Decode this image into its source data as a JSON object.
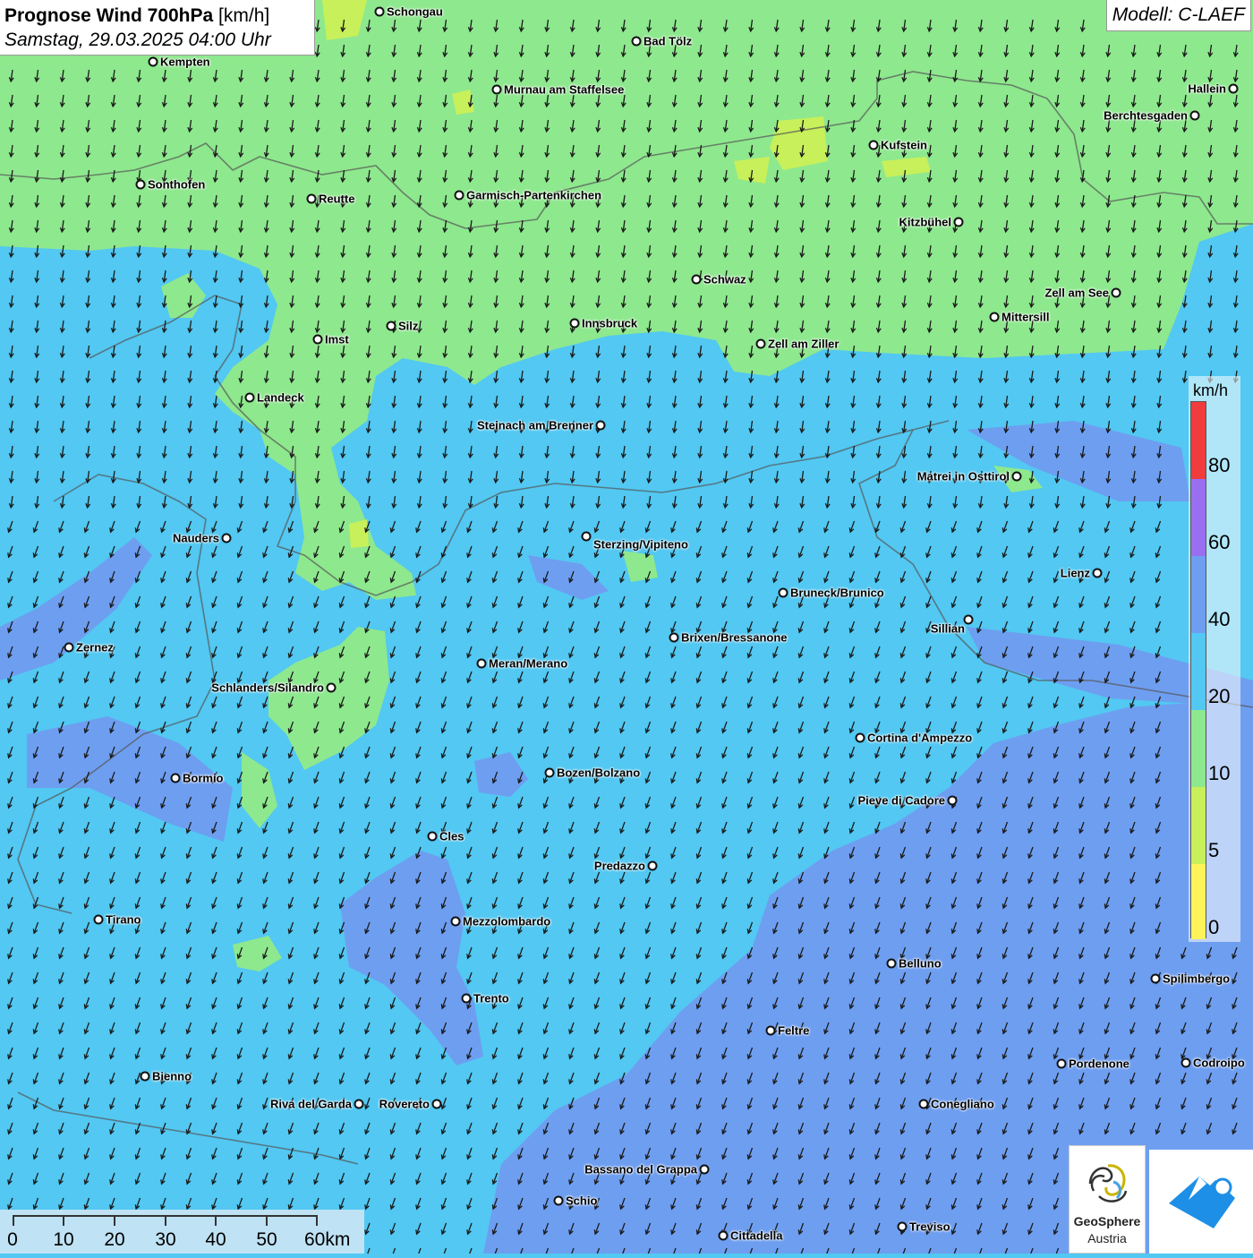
{
  "title": {
    "main": "Prognose Wind 700hPa",
    "unit": "[km/h]",
    "datetime": "Samstag, 29.03.2025 04:00 Uhr"
  },
  "model_label": "Modell: C-LAEF",
  "legend": {
    "unit": "km/h",
    "labels": [
      "80",
      "60",
      "40",
      "20",
      "10",
      "5",
      "0"
    ],
    "colors": {
      "0-5": "#fff35a",
      "5-10": "#c8f05a",
      "10-20": "#8ee88e",
      "20-40": "#52c8f2",
      "40-60": "#6e9ef0",
      "60-80": "#9a6ef0",
      "80+": "#f03c3c"
    }
  },
  "scale": {
    "labels": [
      "0",
      "10",
      "20",
      "30",
      "40",
      "50",
      "60km"
    ]
  },
  "logo": {
    "name": "GeoSphere",
    "country": "Austria"
  },
  "wind": {
    "direction": "from north-northeast (arrows pointing south-southwest)",
    "dominant_class": "20-40"
  },
  "cities": [
    {
      "name": "Schongau"
    },
    {
      "name": "Bad Tölz"
    },
    {
      "name": "Kempten"
    },
    {
      "name": "Murnau am Staffelsee"
    },
    {
      "name": "Hallein"
    },
    {
      "name": "Berchtesgaden"
    },
    {
      "name": "Kufstein"
    },
    {
      "name": "Sonthofen"
    },
    {
      "name": "Reutte"
    },
    {
      "name": "Garmisch-Partenkirchen"
    },
    {
      "name": "Kitzbühel"
    },
    {
      "name": "Schwaz"
    },
    {
      "name": "Zell am See"
    },
    {
      "name": "Innsbruck"
    },
    {
      "name": "Silz"
    },
    {
      "name": "Imst"
    },
    {
      "name": "Mittersill"
    },
    {
      "name": "Zell am Ziller"
    },
    {
      "name": "Landeck"
    },
    {
      "name": "Steinach am Brenner"
    },
    {
      "name": "Matrei in Osttirol"
    },
    {
      "name": "Nauders"
    },
    {
      "name": "Sterzing/Vipiteno"
    },
    {
      "name": "Lienz"
    },
    {
      "name": "Bruneck/Brunico"
    },
    {
      "name": "Sillian"
    },
    {
      "name": "Brixen/Bressanone"
    },
    {
      "name": "Zernez"
    },
    {
      "name": "Meran/Merano"
    },
    {
      "name": "Schlanders/Silandro"
    },
    {
      "name": "Cortina d'Ampezzo"
    },
    {
      "name": "Bozen/Bolzano"
    },
    {
      "name": "Bormio"
    },
    {
      "name": "Pieve di Cadore"
    },
    {
      "name": "Cles"
    },
    {
      "name": "Predazzo"
    },
    {
      "name": "Tirano"
    },
    {
      "name": "Mezzolombardo"
    },
    {
      "name": "Belluno"
    },
    {
      "name": "Spilimbergo"
    },
    {
      "name": "Trento"
    },
    {
      "name": "Feltre"
    },
    {
      "name": "Pordenone"
    },
    {
      "name": "Codroipo"
    },
    {
      "name": "Bienno"
    },
    {
      "name": "Riva del Garda"
    },
    {
      "name": "Rovereto"
    },
    {
      "name": "Conegliano"
    },
    {
      "name": "Bassano del Grappa"
    },
    {
      "name": "Schio"
    },
    {
      "name": "Treviso"
    },
    {
      "name": "Cittadella"
    }
  ]
}
